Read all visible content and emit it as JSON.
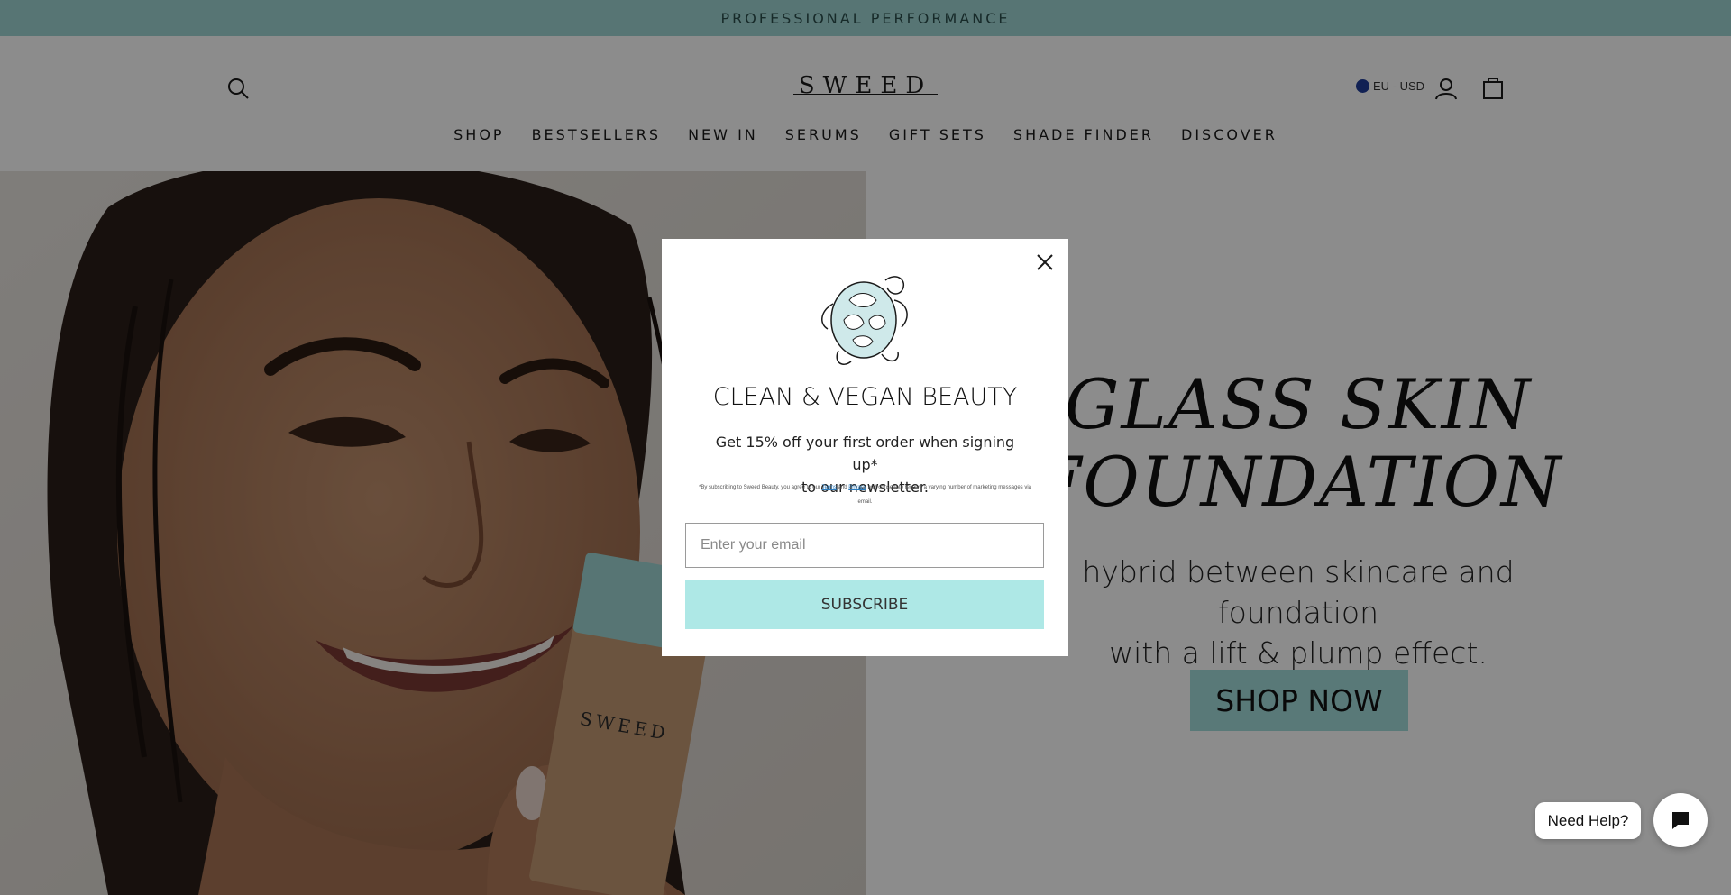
{
  "announcement": "PROFESSIONAL PERFORMANCE",
  "header": {
    "logo": "SWEED",
    "region_label": "EU - USD",
    "search_icon": "search-icon",
    "account_icon": "user-icon",
    "cart_icon": "shopping-bag-icon"
  },
  "nav": {
    "items": [
      "SHOP",
      "BESTSELLERS",
      "NEW IN",
      "SERUMS",
      "GIFT SETS",
      "SHADE FINDER",
      "DISCOVER"
    ]
  },
  "hero": {
    "title_line1": "GLASS SKIN",
    "title_line2": "FOUNDATION",
    "subtitle_line1": "hybrid between skincare and foundation",
    "subtitle_line2": "with a lift & plump effect.",
    "cta": "SHOP NOW",
    "product_brand": "SWEED"
  },
  "modal": {
    "title": "CLEAN & VEGAN BEAUTY",
    "desc_line1": "Get 15% off your first order when signing up*",
    "desc_line2": "to our newsletter.",
    "fine_prefix": "*By subscribing to Sweed Beauty, you agree to our",
    "fine_terms": "Terms",
    "fine_and": "and",
    "fine_privacy": "Privacy",
    "fine_suffix": "and consent to receive a varying number of marketing messages via email.",
    "email_placeholder": "Enter your email",
    "subscribe_label": "SUBSCRIBE",
    "close_icon": "close-icon",
    "illustration": "turtle-illustration"
  },
  "chat": {
    "help_label": "Need Help?",
    "chat_icon": "chat-bubble-icon"
  },
  "colors": {
    "accent": "#a3dcdb",
    "announcement_bg": "#9fd6d4",
    "region_flag": "#1f3d99"
  }
}
